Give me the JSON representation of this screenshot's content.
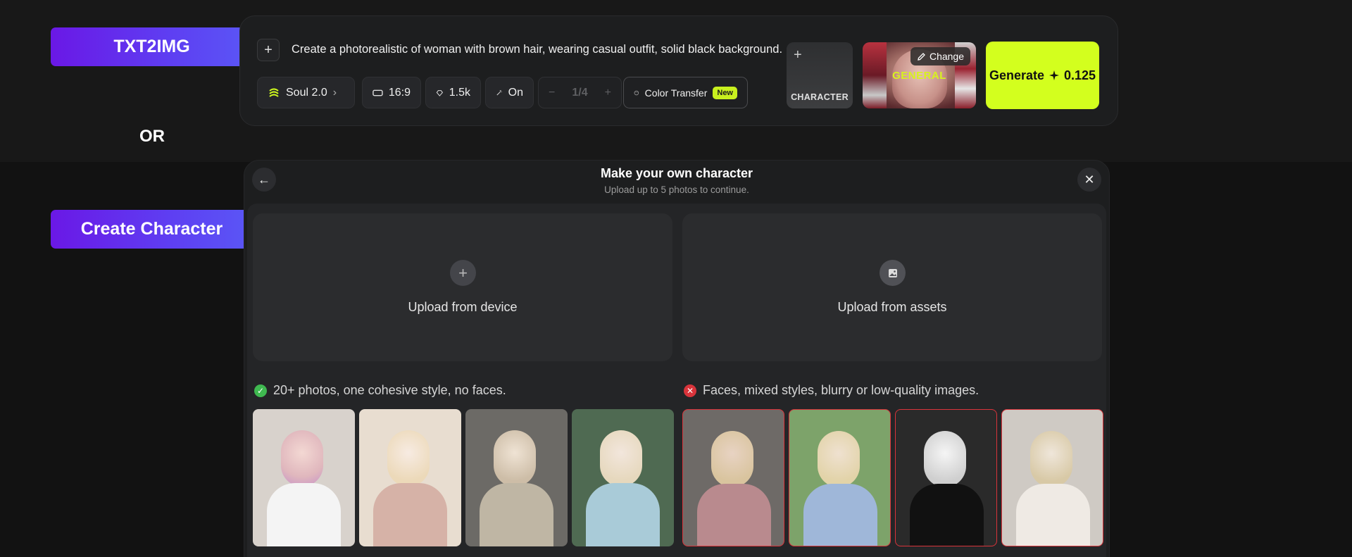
{
  "labels": {
    "txt2img": "TXT2IMG",
    "or": "OR",
    "create_character": "Create Character"
  },
  "prompt_bar": {
    "prompt": "Create a photorealistic of woman with brown hair, wearing casual outfit, solid black background.",
    "model": "Soul 2.0",
    "aspect": "16:9",
    "likes": "1.5k",
    "enhance": "On",
    "batch": "1/4",
    "color_transfer": "Color Transfer",
    "new_badge": "New",
    "character_label": "CHARACTER",
    "general_label": "GENERAL",
    "change_label": "Change",
    "generate_label": "Generate",
    "generate_cost": "0.125"
  },
  "panel": {
    "title": "Make your own character",
    "subtitle": "Upload up to 5 photos to continue.",
    "upload_device": "Upload from device",
    "upload_assets": "Upload from assets",
    "good_rule": "20+ photos, one cohesive style, no faces.",
    "bad_rule": "Faces, mixed styles, blurry or low-quality images."
  },
  "colors": {
    "accent_lime": "#d3ff1e",
    "pill_purple": "#6a18e6",
    "good_green": "#3fb950",
    "bad_red": "#d9343b"
  }
}
